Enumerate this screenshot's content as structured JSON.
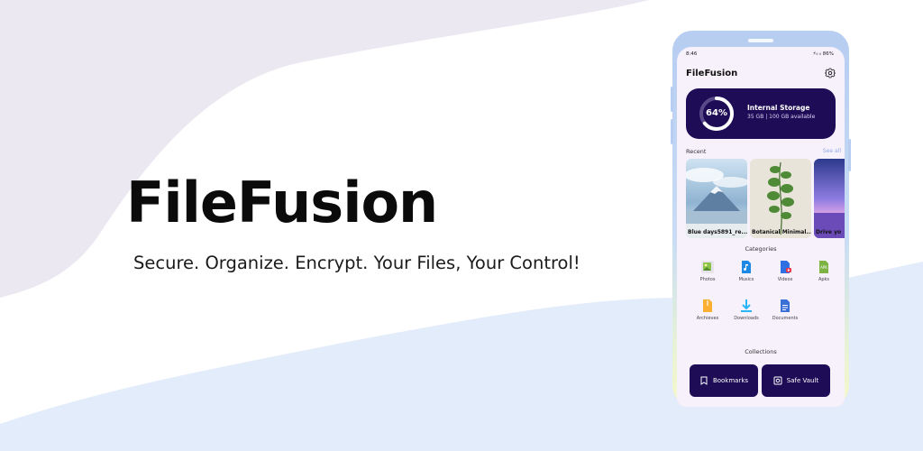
{
  "hero": {
    "title": "FileFusion",
    "tagline": "Secure. Organize. Encrypt. Your Files, Your Control!"
  },
  "phone": {
    "status_bar": {
      "time": "8:46",
      "icons": "⚡ᵢₗ ᵢₗ 86%"
    },
    "app_title": "FileFusion",
    "settings_icon": "gear-icon",
    "storage": {
      "percent": "64%",
      "percent_value": 0.64,
      "title": "Internal Storage",
      "detail": "35 GB | 100 GB available",
      "ring_color": "#ffffff",
      "track_color": "#5a4a8a"
    },
    "recent": {
      "label": "Recent",
      "see_all": "See all",
      "items": [
        {
          "caption": "Blue days5891_re..."
        },
        {
          "caption": "Botanical Minimal..."
        },
        {
          "caption": "Drive yo"
        }
      ]
    },
    "categories": {
      "label": "Categories",
      "items": [
        {
          "label": "Photos",
          "icon": "photos-icon",
          "color": "#8bc34a"
        },
        {
          "label": "Musics",
          "icon": "music-icon",
          "color": "#1e88e5"
        },
        {
          "label": "Videos",
          "icon": "video-icon",
          "color": "#2f6fe4"
        },
        {
          "label": "Apks",
          "icon": "apk-icon",
          "color": "#7cb342"
        },
        {
          "label": "Archieves",
          "icon": "archive-icon",
          "color": "#fbb034"
        },
        {
          "label": "Downloads",
          "icon": "download-icon",
          "color": "#29b6f6"
        },
        {
          "label": "Documents",
          "icon": "document-icon",
          "color": "#3b6fd8"
        }
      ]
    },
    "collections": {
      "label": "Collections",
      "bookmarks": "Bookmarks",
      "safe_vault": "Safe Vault"
    }
  },
  "colors": {
    "accent": "#1e0c56",
    "background_wave_top": "#ece8f1",
    "background_wave_bottom": "#e2ecfb"
  }
}
